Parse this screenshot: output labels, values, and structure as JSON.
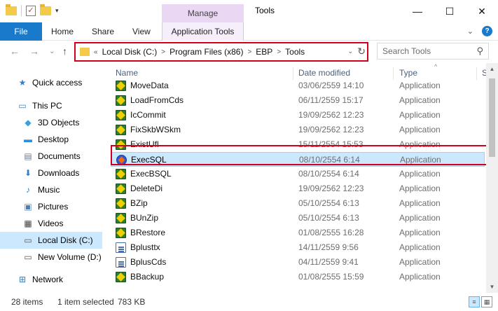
{
  "window": {
    "title": "Tools",
    "manage_tab": "Manage",
    "minimize": "—",
    "maximize": "☐",
    "close": "✕"
  },
  "ribbon": {
    "file": "File",
    "home": "Home",
    "share": "Share",
    "view": "View",
    "app_tools": "Application Tools",
    "expand": "⌄",
    "help": "?"
  },
  "nav": {
    "back": "←",
    "forward": "→",
    "recent": "⌄",
    "up": "↑",
    "crumb_lead": "«",
    "path": [
      "Local Disk (C:)",
      "Program Files (x86)",
      "EBP",
      "Tools"
    ],
    "refresh": "↻",
    "dropdown": "⌄"
  },
  "search": {
    "placeholder": "Search Tools",
    "icon": "⚲"
  },
  "sidebar": {
    "items": [
      {
        "label": "Quick access",
        "icon": "star-icon",
        "glyph": "★",
        "color": "#2f7fd4"
      },
      {
        "label": "This PC",
        "icon": "computer-icon",
        "glyph": "▭",
        "color": "#2b80c8"
      },
      {
        "label": "3D Objects",
        "icon": "cube-icon",
        "glyph": "◆",
        "color": "#3aa0e0"
      },
      {
        "label": "Desktop",
        "icon": "desktop-icon",
        "glyph": "▬",
        "color": "#2d8fd9"
      },
      {
        "label": "Documents",
        "icon": "documents-icon",
        "glyph": "▤",
        "color": "#6b7b8c"
      },
      {
        "label": "Downloads",
        "icon": "download-icon",
        "glyph": "⬇",
        "color": "#2b80c8"
      },
      {
        "label": "Music",
        "icon": "music-icon",
        "glyph": "♪",
        "color": "#2b80c8"
      },
      {
        "label": "Pictures",
        "icon": "pictures-icon",
        "glyph": "▣",
        "color": "#4a7fb5"
      },
      {
        "label": "Videos",
        "icon": "videos-icon",
        "glyph": "▦",
        "color": "#444444"
      },
      {
        "label": "Local Disk (C:)",
        "icon": "drive-icon",
        "glyph": "▭",
        "color": "#555555"
      },
      {
        "label": "New Volume (D:)",
        "icon": "drive-icon",
        "glyph": "▭",
        "color": "#555555"
      },
      {
        "label": "Network",
        "icon": "network-icon",
        "glyph": "⊞",
        "color": "#2b80c8"
      }
    ]
  },
  "columns": {
    "name": "Name",
    "date": "Date modified",
    "type": "Type",
    "size": "S",
    "sort_indicator": "^"
  },
  "files": [
    {
      "name": "MoveData",
      "date": "03/06/2559 14:10",
      "type": "Application",
      "icon": "app"
    },
    {
      "name": "LoadFromCds",
      "date": "06/11/2559 15:17",
      "type": "Application",
      "icon": "app"
    },
    {
      "name": "IcCommit",
      "date": "19/09/2562 12:23",
      "type": "Application",
      "icon": "app"
    },
    {
      "name": "FixSkbWSkm",
      "date": "19/09/2562 12:23",
      "type": "Application",
      "icon": "app"
    },
    {
      "name": "ExistUfl",
      "date": "15/11/2554 15:53",
      "type": "Application",
      "icon": "app"
    },
    {
      "name": "ExecSQL",
      "date": "08/10/2554 6:14",
      "type": "Application",
      "icon": "sql"
    },
    {
      "name": "ExecBSQL",
      "date": "08/10/2554 6:14",
      "type": "Application",
      "icon": "app"
    },
    {
      "name": "DeleteDi",
      "date": "19/09/2562 12:23",
      "type": "Application",
      "icon": "app"
    },
    {
      "name": "BZip",
      "date": "05/10/2554 6:13",
      "type": "Application",
      "icon": "app"
    },
    {
      "name": "BUnZip",
      "date": "05/10/2554 6:13",
      "type": "Application",
      "icon": "app"
    },
    {
      "name": "BRestore",
      "date": "01/08/2555 16:28",
      "type": "Application",
      "icon": "app"
    },
    {
      "name": "Bplusttx",
      "date": "14/11/2559 9:56",
      "type": "Application",
      "icon": "doc"
    },
    {
      "name": "BplusCds",
      "date": "04/11/2559 9:41",
      "type": "Application",
      "icon": "doc"
    },
    {
      "name": "BBackup",
      "date": "01/08/2555 15:59",
      "type": "Application",
      "icon": "app"
    }
  ],
  "scroll": {
    "up": "▲",
    "down": "▼"
  },
  "status": {
    "items": "28 items",
    "selected": "1 item selected",
    "size": "783 KB",
    "details_view": "≡",
    "icons_view": "▦"
  }
}
